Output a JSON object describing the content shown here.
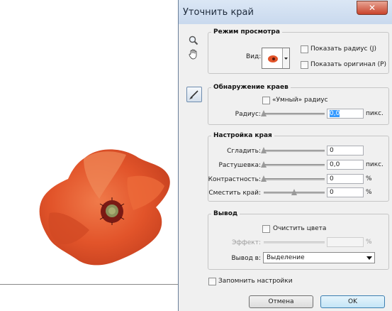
{
  "dialog": {
    "title": "Уточнить край",
    "close_glyph": "✕"
  },
  "tools": {
    "zoom_icon": "magnifier-icon",
    "hand_icon": "hand-icon",
    "brush_icon": "refine-radius-brush-icon"
  },
  "view_mode": {
    "legend": "Режим просмотра",
    "view_label": "Вид:",
    "show_radius": "Показать радиус (J)",
    "show_original": "Показать оригинал (P)"
  },
  "edge_detection": {
    "legend": "Обнаружение краев",
    "smart_radius": "«Умный» радиус",
    "radius_label": "Радиус:",
    "radius_value": "0,0",
    "radius_unit": "пикс.",
    "radius_slider": 0
  },
  "adjust_edge": {
    "legend": "Настройка края",
    "rows": [
      {
        "label": "Сгладить:",
        "value": "0",
        "unit": "",
        "slider": 0
      },
      {
        "label": "Растушевка:",
        "value": "0,0",
        "unit": "пикс.",
        "slider": 0
      },
      {
        "label": "Контрастность:",
        "value": "0",
        "unit": "%",
        "slider": 0
      },
      {
        "label": "Сместить край:",
        "value": "0",
        "unit": "%",
        "slider": 0.5
      }
    ]
  },
  "output": {
    "legend": "Вывод",
    "decontaminate": "Очистить цвета",
    "amount_label": "Эффект:",
    "amount_unit": "%",
    "output_to_label": "Вывод в:",
    "output_to_value": "Выделение"
  },
  "remember": "Запомнить настройки",
  "buttons": {
    "cancel": "Отмена",
    "ok": "OK"
  },
  "colors": {
    "poppy": "#e2542a",
    "poppy_dark": "#b33a18",
    "ok_border": "#3c7fb1"
  }
}
